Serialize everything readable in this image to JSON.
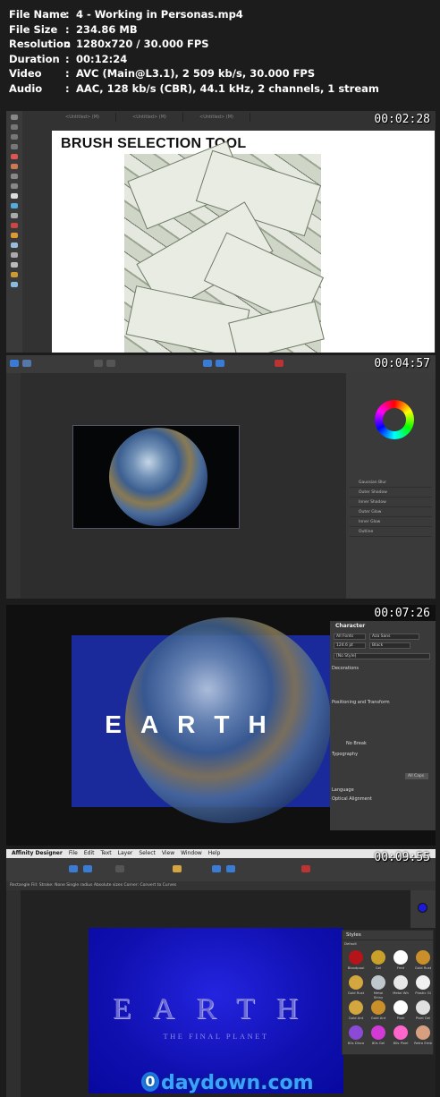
{
  "info": [
    {
      "key": "File Name",
      "value": "4 - Working in Personas.mp4"
    },
    {
      "key": "File Size",
      "value": "234.86 MB"
    },
    {
      "key": "Resolution",
      "value": "1280x720 / 30.000 FPS"
    },
    {
      "key": "Duration",
      "value": "00:12:24"
    },
    {
      "key": "Video",
      "value": "AVC (Main@L3.1), 2 509 kb/s, 30.000 FPS"
    },
    {
      "key": "Audio",
      "value": "AAC, 128 kb/s (CBR), 44.1 kHz, 2 channels, 1 stream"
    }
  ],
  "frames": [
    {
      "timestamp": "00:02:28",
      "canvas_title": "BRUSH SELECTION TOOL",
      "tabs": [
        "<Untitled> (M)",
        "<Untitled> (M)",
        "<Untitled> (M)"
      ]
    },
    {
      "timestamp": "00:04:57",
      "panel_items": [
        "Gaussian Blur",
        "Outer Shadow",
        "Inner Shadow",
        "Outer Glow",
        "Inner Glow",
        "Outline"
      ]
    },
    {
      "timestamp": "00:07:26",
      "canvas_text": "EARTH",
      "panel_title": "Character",
      "font": "Aza Sans",
      "size": "124.6 pt",
      "color_label": "Black",
      "style": "[No Style]",
      "sections": [
        "Decorations",
        "Positioning and Transform",
        "Typography",
        "Language",
        "Optical Alignment"
      ],
      "all_caps": "All Caps",
      "no_break": "No Break"
    },
    {
      "timestamp": "00:09:55",
      "app_menu": [
        "Affinity Designer",
        "File",
        "Edit",
        "Text",
        "Layer",
        "Select",
        "View",
        "Window",
        "Help"
      ],
      "context": "Rectangle   Fill:   Stroke:   None   Single radius   Absolute sizes   Corner:   Convert to Curves",
      "canvas_text": "EARTH",
      "canvas_sub": "THE FINAL PLANET",
      "styles_title": "Styles",
      "styles_default": "Default",
      "swatch_labels": [
        "Bloodpool",
        "Gel",
        "Fred",
        "Gold Rust",
        "Gold Rust",
        "Metal Shiny",
        "Metal Wh",
        "Plastic Gl",
        "Gold Ant",
        "Gold Ant",
        "Pixel",
        "Pixel Gel",
        "80s Disco",
        "80s Gel",
        "80s Pixel",
        "Retro Emb"
      ],
      "swatch_colors": [
        "#b5141a",
        "#c9a12a",
        "#ffffff",
        "#c98f2a",
        "#d4a640",
        "#bfc6cc",
        "#e8e8e8",
        "#f0f0f0",
        "#d4a640",
        "#c98f2a",
        "#ffffff",
        "#e0e0e0",
        "#8a4ad6",
        "#d23ad6",
        "#ff66cc",
        "#d6a080"
      ]
    }
  ],
  "watermark": "daydown.com",
  "watermark_icon": "0"
}
